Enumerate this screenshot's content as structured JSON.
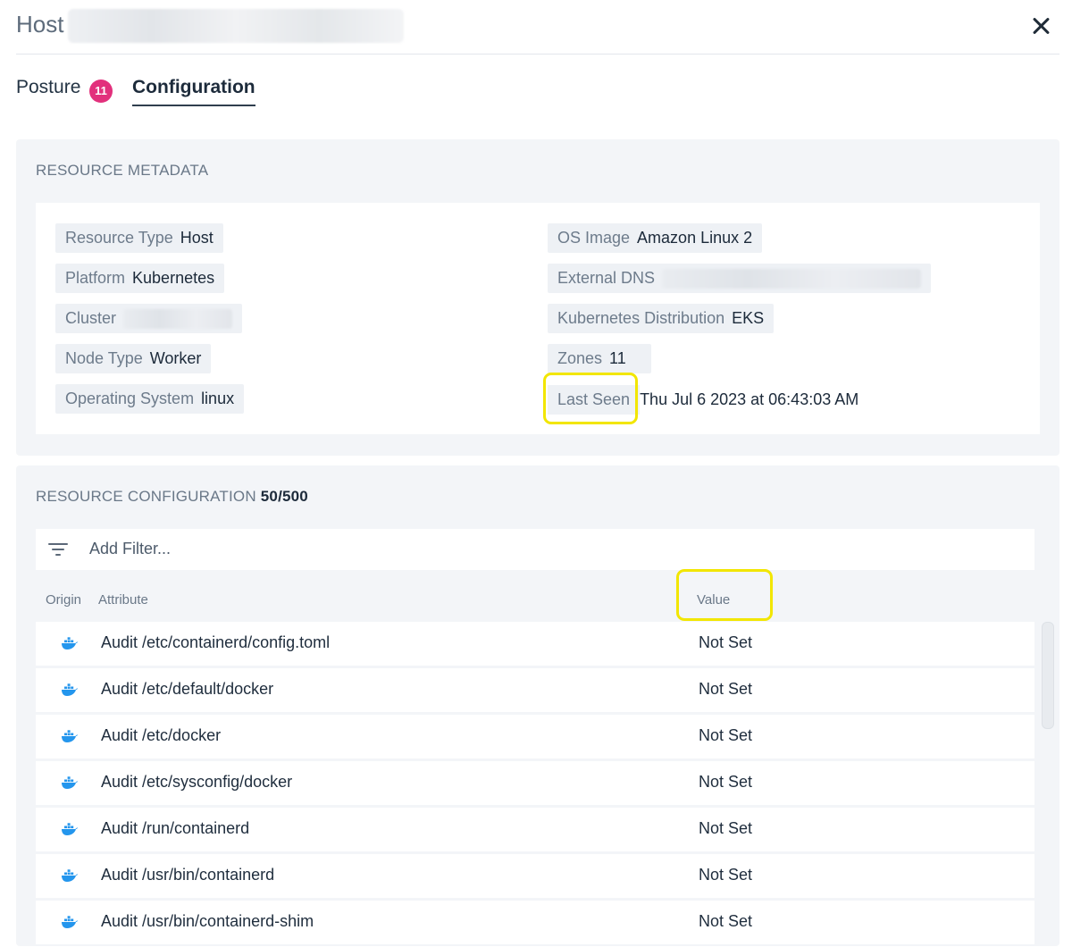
{
  "header": {
    "title": "Host"
  },
  "tabs": [
    {
      "label": "Posture",
      "badge": "11"
    },
    {
      "label": "Configuration"
    }
  ],
  "metadata": {
    "section_title": "RESOURCE METADATA",
    "left": [
      {
        "key": "Resource Type",
        "value": "Host"
      },
      {
        "key": "Platform",
        "value": "Kubernetes"
      },
      {
        "key": "Cluster",
        "value": ""
      },
      {
        "key": "Node Type",
        "value": "Worker"
      },
      {
        "key": "Operating System",
        "value": "linux"
      }
    ],
    "right": [
      {
        "key": "OS Image",
        "value": "Amazon Linux 2"
      },
      {
        "key": "External DNS",
        "value": ""
      },
      {
        "key": "Kubernetes Distribution",
        "value": "EKS"
      },
      {
        "key": "Zones",
        "value": "11"
      },
      {
        "key": "Last Seen",
        "value": "Thu Jul 6 2023 at 06:43:03 AM"
      }
    ]
  },
  "configuration": {
    "section_title": "RESOURCE CONFIGURATION",
    "count": "50/500",
    "filter_placeholder": "Add Filter...",
    "columns": {
      "origin": "Origin",
      "attribute": "Attribute",
      "value": "Value"
    },
    "rows": [
      {
        "origin_icon": "docker-icon",
        "attribute": "Audit /etc/containerd/config.toml",
        "value": "Not Set"
      },
      {
        "origin_icon": "docker-icon",
        "attribute": "Audit /etc/default/docker",
        "value": "Not Set"
      },
      {
        "origin_icon": "docker-icon",
        "attribute": "Audit /etc/docker",
        "value": "Not Set"
      },
      {
        "origin_icon": "docker-icon",
        "attribute": "Audit /etc/sysconfig/docker",
        "value": "Not Set"
      },
      {
        "origin_icon": "docker-icon",
        "attribute": "Audit /run/containerd",
        "value": "Not Set"
      },
      {
        "origin_icon": "docker-icon",
        "attribute": "Audit /usr/bin/containerd",
        "value": "Not Set"
      },
      {
        "origin_icon": "docker-icon",
        "attribute": "Audit /usr/bin/containerd-shim",
        "value": "Not Set"
      }
    ]
  },
  "colors": {
    "badge": "#e2307c",
    "highlight": "#f2e600",
    "docker": "#2496ed"
  }
}
